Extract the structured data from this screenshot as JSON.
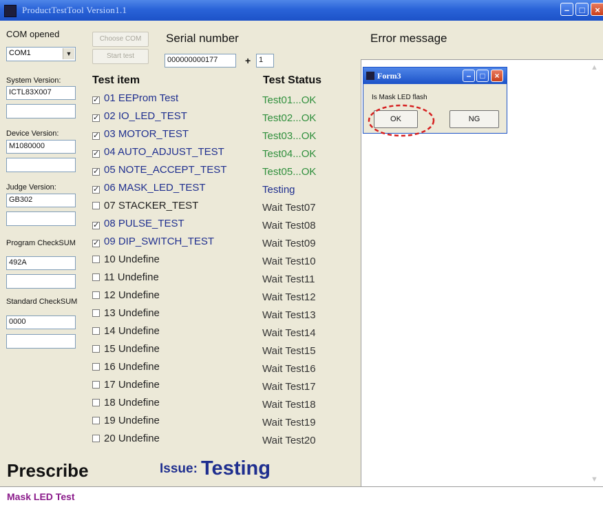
{
  "window": {
    "title": "ProductTestTool  Version1.1"
  },
  "left_panel": {
    "com_opened_label": "COM opened",
    "com_port_value": "COM1",
    "choose_com_label": "Choose COM",
    "start_test_label": "Start test",
    "system_version_label": "System Version:",
    "system_version_value": "ICTL83X007",
    "device_version_label": "Device Version:",
    "device_version_value": "M1080000",
    "judge_version_label": "Judge Version:",
    "judge_version_value": "GB302",
    "program_checksum_label": "Program CheckSUM",
    "program_checksum_value": "492A",
    "standard_checksum_label": "Standard CheckSUM",
    "standard_checksum_value": "0000"
  },
  "serial": {
    "label": "Serial number",
    "value": "000000000177",
    "plus": "+",
    "increment": "1"
  },
  "tests": {
    "item_header": "Test item",
    "status_header": "Test Status",
    "items": [
      {
        "label": "01 EEProm Test",
        "checked": true,
        "status": "Test01...OK"
      },
      {
        "label": "02 IO_LED_TEST",
        "checked": true,
        "status": "Test02...OK"
      },
      {
        "label": "03 MOTOR_TEST",
        "checked": true,
        "status": "Test03...OK"
      },
      {
        "label": "04 AUTO_ADJUST_TEST",
        "checked": true,
        "status": "Test04...OK"
      },
      {
        "label": "05 NOTE_ACCEPT_TEST",
        "checked": true,
        "status": "Test05...OK"
      },
      {
        "label": "06 MASK_LED_TEST",
        "checked": true,
        "status": "Testing"
      },
      {
        "label": "07 STACKER_TEST",
        "checked": false,
        "status": "Wait Test07"
      },
      {
        "label": "08 PULSE_TEST",
        "checked": true,
        "status": "Wait Test08"
      },
      {
        "label": "09 DIP_SWITCH_TEST",
        "checked": true,
        "status": "Wait Test09"
      },
      {
        "label": "10 Undefine",
        "checked": false,
        "status": "Wait Test10"
      },
      {
        "label": "11 Undefine",
        "checked": false,
        "status": "Wait Test11"
      },
      {
        "label": "12 Undefine",
        "checked": false,
        "status": "Wait Test12"
      },
      {
        "label": "13 Undefine",
        "checked": false,
        "status": "Wait Test13"
      },
      {
        "label": "14 Undefine",
        "checked": false,
        "status": "Wait Test14"
      },
      {
        "label": "15 Undefine",
        "checked": false,
        "status": "Wait Test15"
      },
      {
        "label": "16 Undefine",
        "checked": false,
        "status": "Wait Test16"
      },
      {
        "label": "17 Undefine",
        "checked": false,
        "status": "Wait Test17"
      },
      {
        "label": "18 Undefine",
        "checked": false,
        "status": "Wait Test18"
      },
      {
        "label": "19 Undefine",
        "checked": false,
        "status": "Wait Test19"
      },
      {
        "label": "20 Undefine",
        "checked": false,
        "status": "Wait Test20"
      }
    ]
  },
  "footer": {
    "prescribe_label": "Prescribe",
    "issue_label": "Issue:",
    "issue_value": "Testing"
  },
  "error_panel": {
    "label": "Error message"
  },
  "dialog": {
    "title": "Form3",
    "question": "Is Mask LED flash",
    "ok_label": "OK",
    "ng_label": "NG"
  },
  "status_bar": {
    "text": "Mask LED Test"
  },
  "colors": {
    "ok_status": "#2f8f3c",
    "testing_status": "#1f2f8f",
    "highlight_ring": "#d62020",
    "status_bar_text": "#8a1a8a"
  },
  "icons": {
    "window_controls": [
      "minimize-icon",
      "maximize-icon",
      "close-icon"
    ],
    "checkbox_checked_glyph": "✓",
    "combo_arrow_glyph": "▼"
  }
}
